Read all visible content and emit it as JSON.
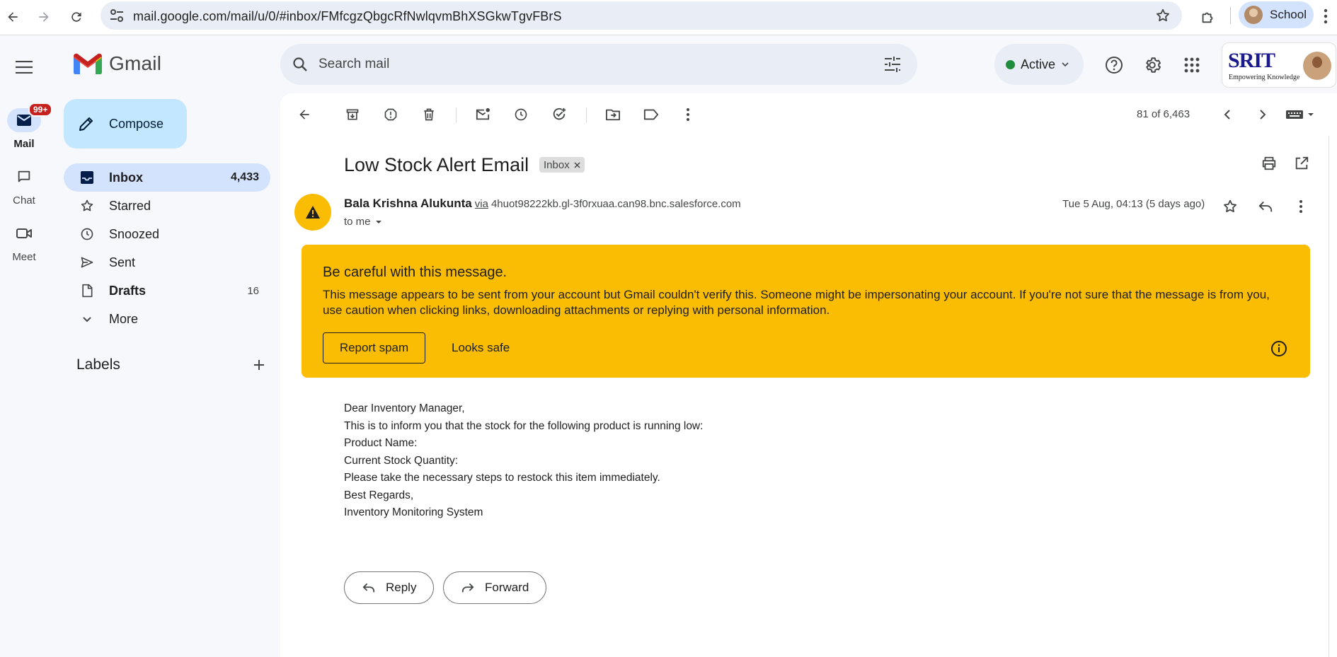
{
  "browser": {
    "url": "mail.google.com/mail/u/0/#inbox/FMfcgzQbgcRfNwlqvmBhXSGkwTgvFBrS",
    "profile_name": "School"
  },
  "app": {
    "name": "Gmail",
    "accent": "#0b57d0",
    "warning_color": "#fbbc04"
  },
  "rail": {
    "mail_label": "Mail",
    "mail_badge": "99+",
    "chat_label": "Chat",
    "meet_label": "Meet"
  },
  "sidebar": {
    "compose": "Compose",
    "folders": [
      {
        "label": "Inbox",
        "count": "4,433",
        "icon": "inbox-icon"
      },
      {
        "label": "Starred",
        "count": "",
        "icon": "star-icon"
      },
      {
        "label": "Snoozed",
        "count": "",
        "icon": "clock-icon"
      },
      {
        "label": "Sent",
        "count": "",
        "icon": "send-icon"
      },
      {
        "label": "Drafts",
        "count": "16",
        "icon": "draft-icon"
      },
      {
        "label": "More",
        "count": "",
        "icon": "chevron-down-icon"
      }
    ],
    "labels_heading": "Labels"
  },
  "topbar": {
    "search_placeholder": "Search mail",
    "status": "Active",
    "brand_text": "SRIT",
    "brand_tagline": "Empowering Knowledge"
  },
  "toolbar": {
    "pager": "81 of 6,463"
  },
  "email": {
    "subject": "Low Stock Alert Email",
    "label_chip": "Inbox",
    "sender_name": "Bala Krishna Alukunta",
    "via": "via",
    "sender_address": "4huot98222kb.gl-3f0rxuaa.can98.bnc.salesforce.com",
    "to": "to me",
    "date": "Tue 5 Aug, 04:13 (5 days ago)",
    "warning": {
      "title": "Be careful with this message.",
      "text": "This message appears to be sent from your account but Gmail couldn't verify this. Someone might be impersonating your account. If you're not sure that the message is from you, use caution when clicking links, downloading attachments or replying with personal information.",
      "report_spam": "Report spam",
      "looks_safe": "Looks safe"
    },
    "body_lines": [
      "Dear Inventory Manager,",
      "This is to inform you that the stock for the following product is running low:",
      "Product Name:",
      "Current Stock Quantity:",
      "Please take the necessary steps to restock this item immediately.",
      "Best Regards,",
      "Inventory Monitoring System"
    ],
    "reply": "Reply",
    "forward": "Forward"
  }
}
